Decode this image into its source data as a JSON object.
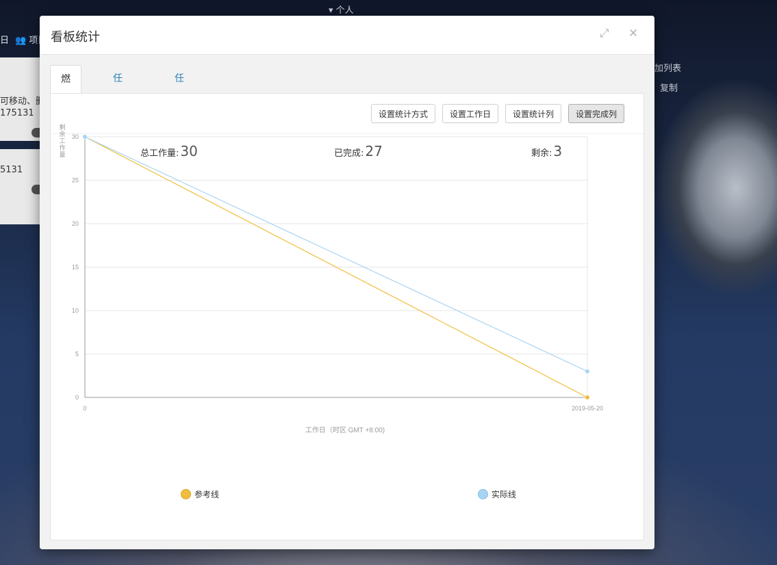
{
  "background": {
    "top_tab": "个人",
    "nav_label": "项目",
    "nav_prefix": "日",
    "card1_line1": "可移动、删",
    "card1_line2": "175131",
    "card2_line1": "5131",
    "right_link1": "加列表",
    "right_link2": "复制"
  },
  "modal": {
    "title": "看板统计",
    "expand_icon": "expand-icon",
    "close_icon": "close-icon"
  },
  "tabs": [
    {
      "label": "燃尽图",
      "active": true
    },
    {
      "label": "任务分布",
      "active": false
    },
    {
      "label": "任务周期",
      "active": false
    }
  ],
  "toolbar": {
    "buttons": [
      "设置统计方式",
      "设置工作日",
      "设置统计列",
      "设置完成列"
    ]
  },
  "stats": {
    "total_label": "总工作量:",
    "total_value": "30",
    "done_label": "已完成:",
    "done_value": "27",
    "remaining_label": "剩余:",
    "remaining_value": "3"
  },
  "colors": {
    "reference": "#f0be3c",
    "actual": "#a8d4f2",
    "grid": "#e6e6e6",
    "axis": "#999999"
  },
  "chart_data": {
    "type": "line",
    "x": [
      "0",
      "2019-05-20"
    ],
    "ylabel": "剩余工作量",
    "xlabel": "工作日（时区 GMT +8:00)",
    "ylim": [
      0,
      30
    ],
    "yticks": [
      0,
      5,
      10,
      15,
      20,
      25,
      30
    ],
    "grid": true,
    "legend": "bottom",
    "series": [
      {
        "name": "参考线",
        "values": [
          30,
          0
        ],
        "color": "#f0be3c"
      },
      {
        "name": "实际线",
        "values": [
          30,
          3
        ],
        "color": "#a8d4f2"
      }
    ]
  }
}
